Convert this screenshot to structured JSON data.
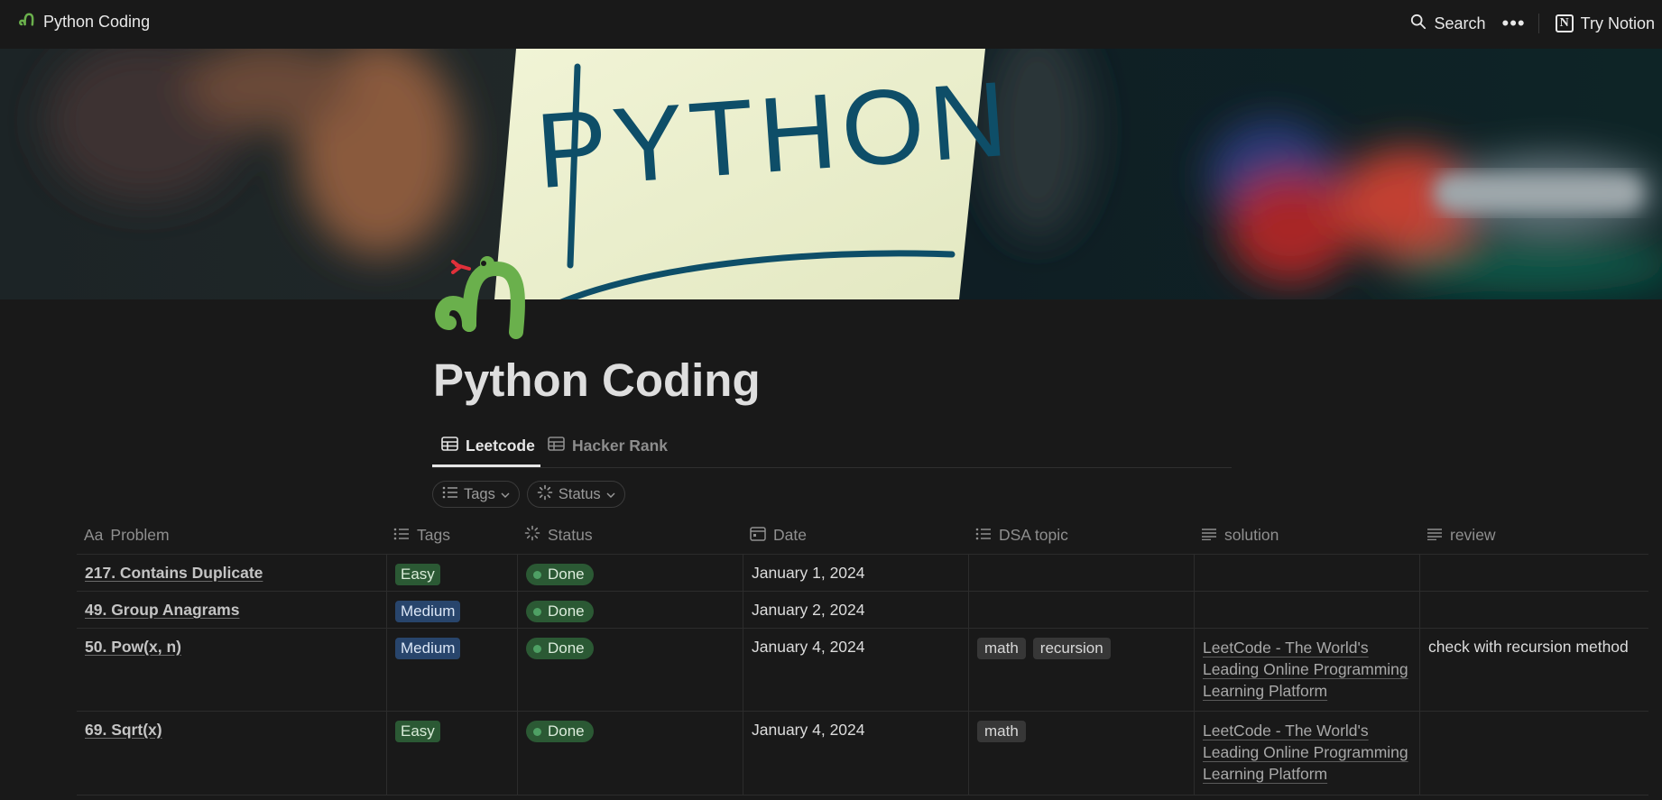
{
  "topbar": {
    "breadcrumb_title": "Python Coding",
    "search_label": "Search",
    "more_icon": "more-icon",
    "try_notion_label": "Try Notion"
  },
  "cover": {
    "sign_text": "PYTHON"
  },
  "page": {
    "title": "Python Coding",
    "icon": "snake-icon"
  },
  "views": [
    {
      "label": "Leetcode",
      "active": true
    },
    {
      "label": "Hacker Rank",
      "active": false
    }
  ],
  "filters": [
    {
      "label": "Tags"
    },
    {
      "label": "Status"
    }
  ],
  "table": {
    "columns": [
      {
        "label": "Problem",
        "prefix": "Aa"
      },
      {
        "label": "Tags"
      },
      {
        "label": "Status"
      },
      {
        "label": "Date"
      },
      {
        "label": "DSA topic"
      },
      {
        "label": "solution"
      },
      {
        "label": "review"
      }
    ],
    "rows": [
      {
        "problem": "217. Contains Duplicate",
        "tag": "Easy",
        "status": "Done",
        "date": "January 1, 2024",
        "dsa": [],
        "solution": [],
        "review": ""
      },
      {
        "problem": "49. Group Anagrams",
        "tag": "Medium",
        "status": "Done",
        "date": "January 2, 2024",
        "dsa": [],
        "solution": [],
        "review": ""
      },
      {
        "problem": "50. Pow(x, n)",
        "tag": "Medium",
        "status": "Done",
        "date": "January 4, 2024",
        "dsa": [
          "math",
          "recursion"
        ],
        "solution": [
          "LeetCode - The World's",
          "Leading Online Programming",
          "Learning Platform"
        ],
        "review": "check with recursion method"
      },
      {
        "problem": "69. Sqrt(x)",
        "tag": "Easy",
        "status": "Done",
        "date": "January 4, 2024",
        "dsa": [
          "math"
        ],
        "solution": [
          "LeetCode - The World's",
          "Leading Online Programming",
          "Learning Platform"
        ],
        "review": ""
      }
    ]
  },
  "colors": {
    "background": "#191919",
    "tag_easy": "#2b5934",
    "tag_medium": "#28456c",
    "status_done": "#2b5934",
    "snake_green": "#6ab04c"
  }
}
